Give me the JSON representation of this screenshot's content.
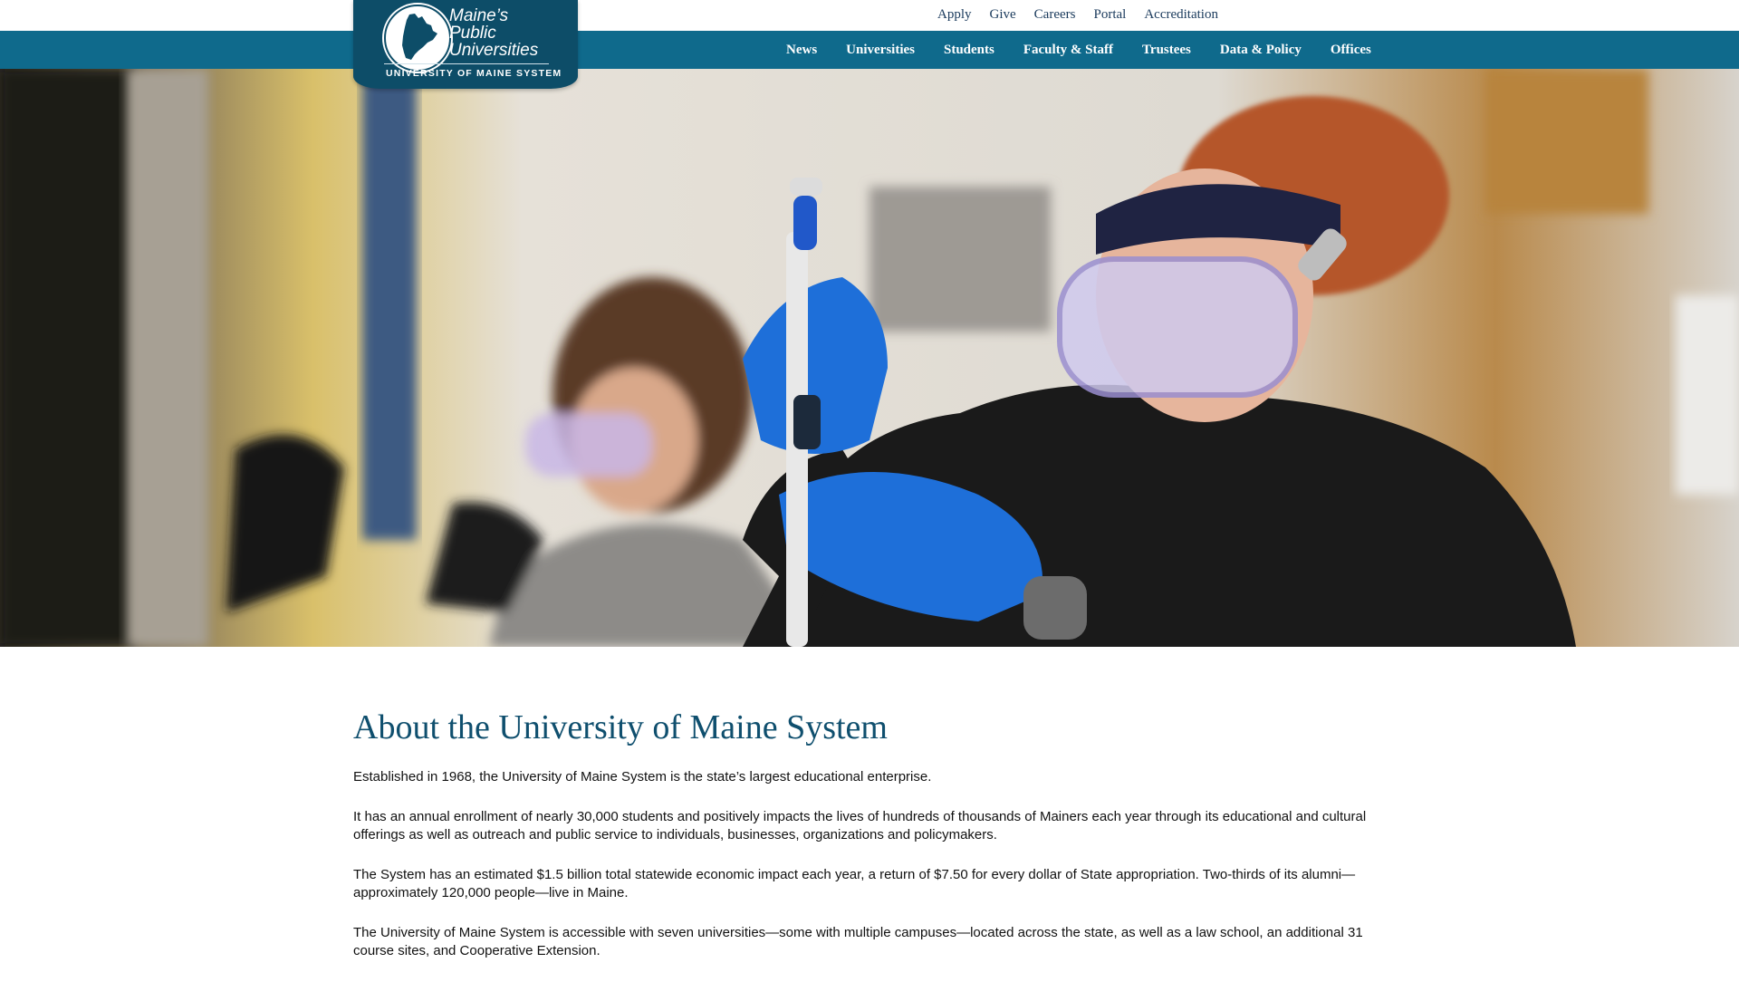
{
  "utility_nav": {
    "items": [
      "Apply",
      "Give",
      "Careers",
      "Portal",
      "Accreditation"
    ]
  },
  "main_nav": {
    "items": [
      "News",
      "Universities",
      "Students",
      "Faculty & Staff",
      "Trustees",
      "Data & Policy",
      "Offices"
    ]
  },
  "logo": {
    "line1": "Maine’s",
    "line2": "Public",
    "line3": "Universities",
    "subtitle": "UNIVERSITY OF MAINE SYSTEM"
  },
  "hero": {
    "icon": "hero-photo",
    "colors": {
      "glove": "#1e6fd9",
      "hoodie": "#1a1a1a",
      "hair": "#b5572a",
      "nav": "#0f6a8c",
      "logo": "#0d4d68"
    }
  },
  "content": {
    "title": "About the University of Maine System",
    "paragraphs": [
      "Established in 1968, the University of Maine System is the state’s largest educational enterprise.",
      "It has an annual enrollment of nearly 30,000 students and positively impacts the lives of hundreds of thousands of Mainers each year through its educational and cultural offerings as well as outreach and public service to individuals, businesses, organizations and policymakers.",
      "The System has an estimated $1.5 billion total statewide economic impact each year, a return of $7.50 for every dollar of State appropriation. Two-thirds of its alumni—approximately 120,000 people—live in Maine.",
      "The University of Maine System is accessible with seven universities—some with multiple campuses—located across the state, as well as a law school, an additional 31 course sites, and Cooperative Extension."
    ]
  }
}
